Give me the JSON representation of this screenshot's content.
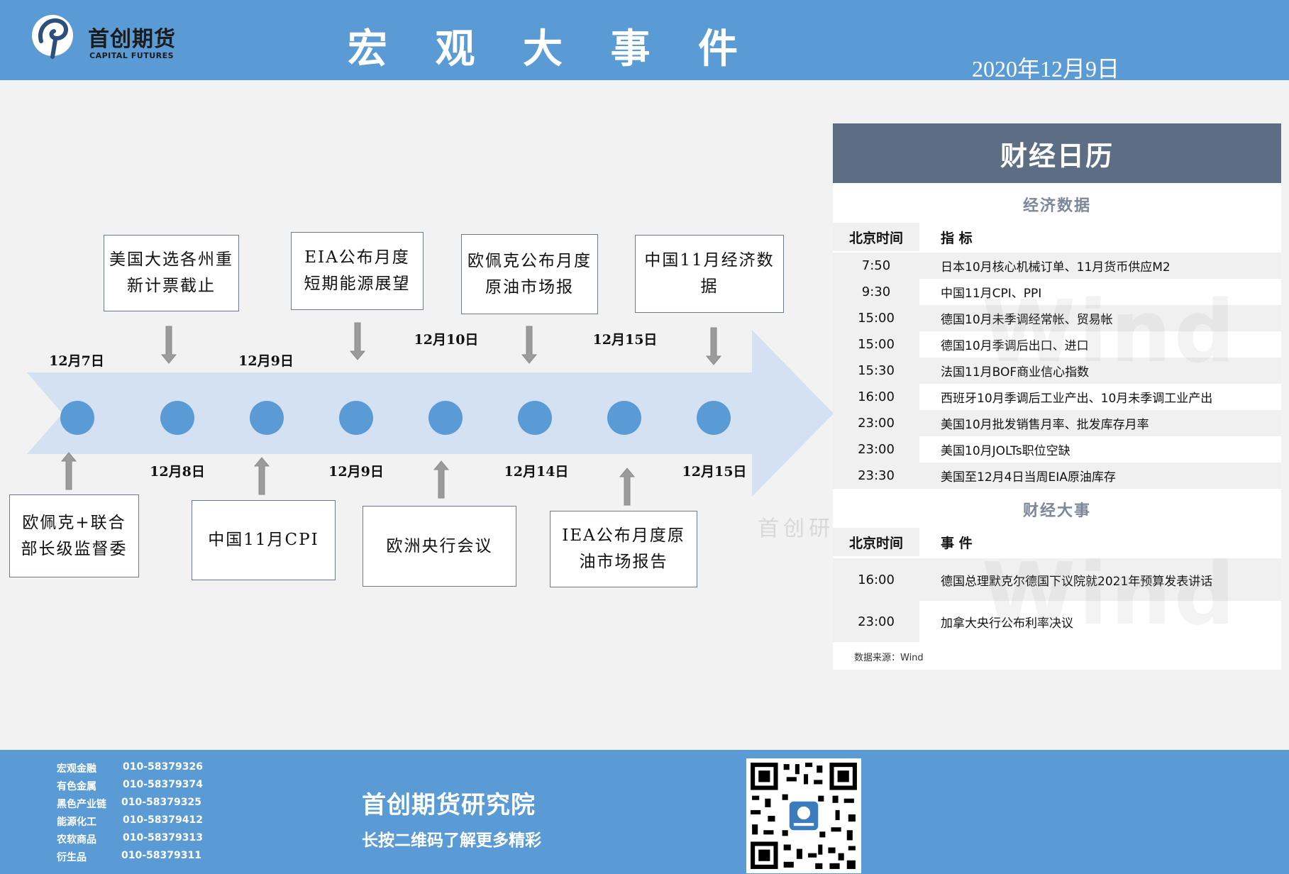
{
  "header": {
    "logo_cn": "首创期货",
    "logo_en": "CAPITAL FUTURES",
    "title": "宏 观 大 事 件",
    "date": "2020年12月9日"
  },
  "colors": {
    "header_bg": "#5b9bd5",
    "timeline_arrow": "#d3e1f3",
    "timeline_node": "#5b9bd5",
    "calendar_title_bg": "#5d6e84"
  },
  "timeline": {
    "top_events": [
      {
        "text": "美国大选各州重新计票截止",
        "date": "12月8日"
      },
      {
        "text": "EIA公布月度短期能源展望",
        "date": "12月9日"
      },
      {
        "text": "欧佩克公布月度原油市场报",
        "date": "12月14日"
      },
      {
        "text": "中国11月经济数据",
        "date": "12月15日"
      }
    ],
    "bottom_events": [
      {
        "text": "欧佩克+联合部长级监督委",
        "date": "12月7日"
      },
      {
        "text": "中国11月CPI",
        "date": "12月9日"
      },
      {
        "text": "欧洲央行会议",
        "date": "12月10日"
      },
      {
        "text": "IEA公布月度原油市场报告",
        "date": "12月15日"
      }
    ],
    "top_dates": [
      "12月7日",
      "12月9日",
      "12月10日",
      "12月15日"
    ],
    "bottom_dates": [
      "12月8日",
      "12月9日",
      "12月14日",
      "12月15日"
    ],
    "box_texts": {
      "t1": "美国大选各州重新计票截止",
      "t2": "EIA公布月度短期能源展望",
      "t3": "欧佩克公布月度原油市场报",
      "t4": "中国11月经济数据",
      "b1": "欧佩克+联合部长级监督委",
      "b2": "中国11月CPI",
      "b3": "欧洲央行会议",
      "b4": "IEA公布月度原油市场报告"
    }
  },
  "calendar": {
    "title": "财经日历",
    "econ_section": "经济数据",
    "col_time": "北京时间",
    "col_indicator": "指  标",
    "econ_rows": [
      {
        "time": "7:50",
        "item": "日本10月核心机械订单、11月货币供应M2"
      },
      {
        "time": "9:30",
        "item": "中国11月CPI、PPI"
      },
      {
        "time": "15:00",
        "item": "德国10月未季调经常帐、贸易帐"
      },
      {
        "time": "15:00",
        "item": "德国10月季调后出口、进口"
      },
      {
        "time": "15:30",
        "item": "法国11月BOF商业信心指数"
      },
      {
        "time": "16:00",
        "item": "西班牙10月季调后工业产出、10月未季调工业产出"
      },
      {
        "time": "23:00",
        "item": "美国10月批发销售月率、批发库存月率"
      },
      {
        "time": "23:00",
        "item": "美国10月JOLTs职位空缺"
      },
      {
        "time": "23:30",
        "item": "美国至12月4日当周EIA原油库存"
      }
    ],
    "events_section": "财经大事",
    "col_event": "事  件",
    "event_rows": [
      {
        "time": "16:00",
        "item": "德国总理默克尔德国下议院就2021年预算发表讲话"
      },
      {
        "time": "23:00",
        "item": "加拿大央行公布利率决议"
      }
    ],
    "source": "数据来源：Wind",
    "watermark": "Wind",
    "watermark_cn": "首创研"
  },
  "footer": {
    "contacts": [
      {
        "dept": "宏观金融",
        "phone": "010-58379326"
      },
      {
        "dept": "有色金属",
        "phone": "010-58379374"
      },
      {
        "dept": "黑色产业链",
        "phone": "010-58379325"
      },
      {
        "dept": "能源化工",
        "phone": "010-58379412"
      },
      {
        "dept": "农软商品",
        "phone": "010-58379313"
      },
      {
        "dept": "衍生品",
        "phone": "010-58379311"
      }
    ],
    "title": "首创期货研究院",
    "subtitle": "长按二维码了解更多精彩",
    "qr_icon": "qr-code-icon"
  }
}
